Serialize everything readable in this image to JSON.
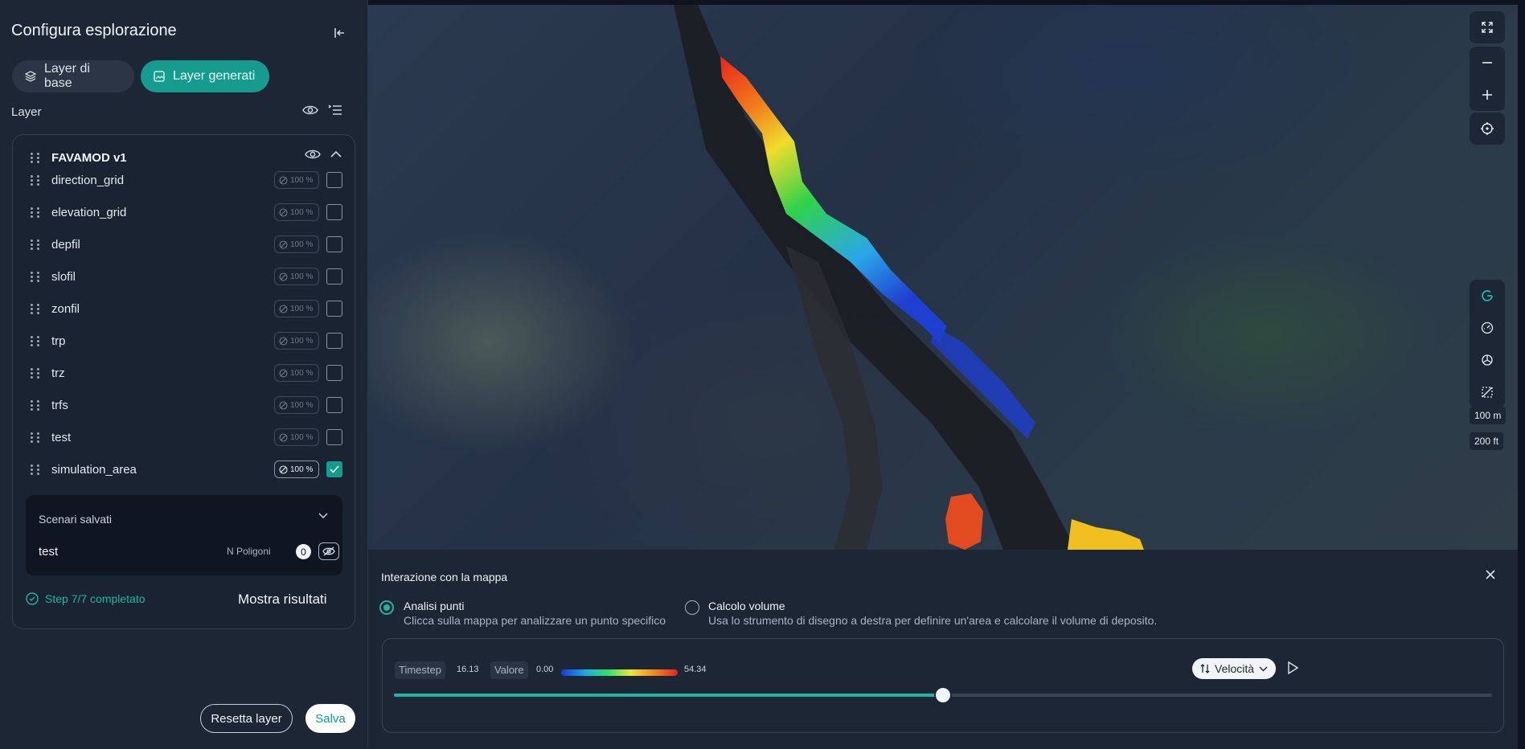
{
  "panel": {
    "title": "Configura esplorazione",
    "tabs": [
      {
        "label": "Layer di base",
        "active": false
      },
      {
        "label": "Layer generati",
        "active": true
      }
    ],
    "layer_heading": "Layer",
    "group": {
      "name": "FAVAMOD v1"
    },
    "layers": [
      {
        "name": "direction_grid",
        "opacity": "100 %",
        "checked": false
      },
      {
        "name": "elevation_grid",
        "opacity": "100 %",
        "checked": false
      },
      {
        "name": "depfil",
        "opacity": "100 %",
        "checked": false
      },
      {
        "name": "slofil",
        "opacity": "100 %",
        "checked": false
      },
      {
        "name": "zonfil",
        "opacity": "100 %",
        "checked": false
      },
      {
        "name": "trp",
        "opacity": "100 %",
        "checked": false
      },
      {
        "name": "trz",
        "opacity": "100 %",
        "checked": false
      },
      {
        "name": "trfs",
        "opacity": "100 %",
        "checked": false
      },
      {
        "name": "test",
        "opacity": "100 %",
        "checked": false
      },
      {
        "name": "simulation_area",
        "opacity": "100 %",
        "checked": true
      }
    ],
    "scenarios": {
      "title": "Scenari salvati",
      "item": {
        "name": "test",
        "polygons_label": "N Poligoni",
        "polygons_count": "0"
      }
    },
    "step": "Step 7/7 completato",
    "show_results": "Mostra risultati",
    "reset_label": "Resetta layer",
    "save_label": "Salva"
  },
  "map": {
    "scale_m": "100 m",
    "scale_ft": "200 ft",
    "controls": [
      "fullscreen-icon",
      "zoom-out-icon",
      "zoom-in-icon",
      "locate-icon"
    ],
    "tools": [
      "google-icon",
      "dashboard-icon",
      "openai-icon",
      "measure-icon"
    ]
  },
  "interaction": {
    "title": "Interazione con la mappa",
    "options": [
      {
        "title": "Analisi punti",
        "desc": "Clicca sulla mappa per analizzare un punto specifico",
        "selected": true
      },
      {
        "title": "Calcolo volume",
        "desc": "Usa lo strumento di disegno a destra per definire un'area e calcolare il volume di deposito.",
        "selected": false
      }
    ],
    "timestep_label": "Timestep",
    "timestep_value": "16.13",
    "valore_label": "Valore",
    "min_value": "0.00",
    "max_value": "54.34",
    "variable": "Velocità",
    "progress": 0.5
  },
  "colors": {
    "accent": "#159c8e",
    "panel": "#1d2635"
  }
}
